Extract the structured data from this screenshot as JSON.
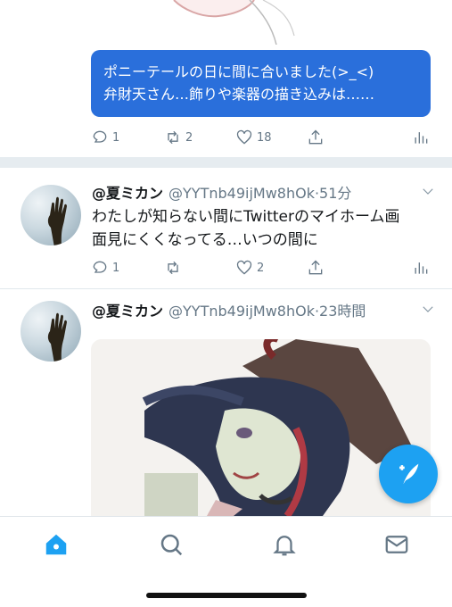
{
  "tweet_top": {
    "banner_text_line1": "ポニーテールの日に間に合いました(>_<)",
    "banner_text_line2": "弁財天さん…飾りや楽器の描き込みは……",
    "reply_count": "1",
    "retweet_count": "2",
    "like_count": "18"
  },
  "tweet_1": {
    "display_name": "@夏ミカン",
    "handle_time": "@YYTnb49ijMw8hOk·51分",
    "text_line1": "わたしが知らない間にTwitterのマイホーム画",
    "text_line2": "面見にくくなってる…いつの間に",
    "reply_count": "1",
    "retweet_count": "",
    "like_count": "2"
  },
  "tweet_2": {
    "display_name": "@夏ミカン",
    "handle_time": "@YYTnb49ijMw8hOk·23時間"
  },
  "icons": {
    "reply": "reply-icon",
    "retweet": "retweet-icon",
    "like": "heart-icon",
    "share": "share-icon",
    "analytics": "analytics-icon",
    "more": "chevron-down-icon",
    "compose": "compose-tweet-icon",
    "tabs": [
      "home-icon",
      "search-icon",
      "notifications-icon",
      "messages-icon"
    ]
  },
  "colors": {
    "accent": "#1da1f2",
    "banner": "#2a6fdb",
    "muted": "#657786"
  }
}
